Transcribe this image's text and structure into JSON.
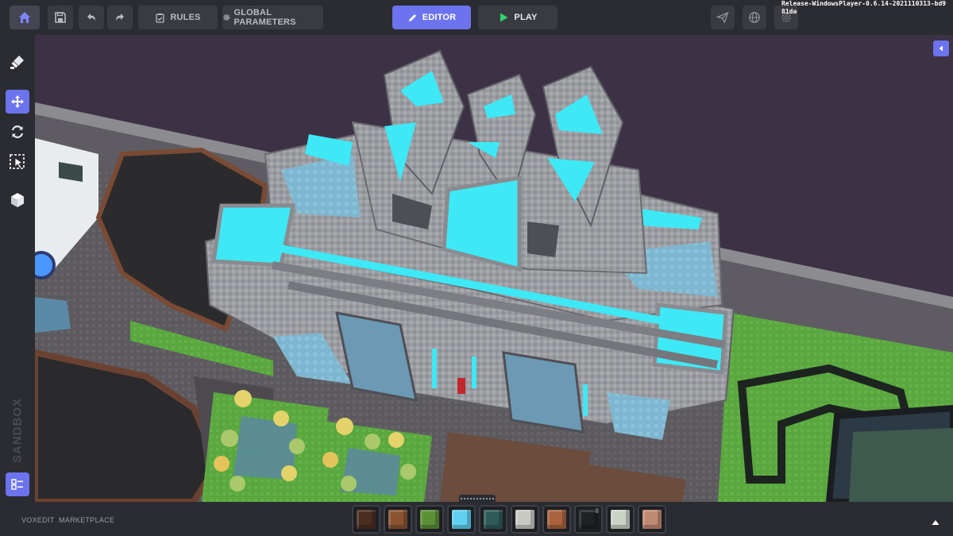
{
  "topbar": {
    "rules_label": "RULES",
    "global_params_label": "GLOBAL PARAMETERS",
    "editor_label": "EDITOR",
    "play_label": "PLAY",
    "version_text": "Release-WindowsPlayer-0.6.14-2021110313-bd981da"
  },
  "sidebar": {
    "logo_text": "SANDBOX"
  },
  "bottombar": {
    "voxedit_label": "VOXEDIT",
    "marketplace_label": "MARKETPLACE"
  },
  "hotbar": {
    "slots": [
      {
        "num": "",
        "name": "dark-wood-block",
        "color": "#4a2e1f"
      },
      {
        "num": "",
        "name": "brown-block",
        "color": "#8a5433"
      },
      {
        "num": "",
        "name": "grass-block",
        "color": "#5b8f36"
      },
      {
        "num": "",
        "name": "ice-block",
        "color": "#5fd0ef"
      },
      {
        "num": "",
        "name": "teal-block",
        "color": "#2e5a58"
      },
      {
        "num": "",
        "name": "light-stone-block",
        "color": "#c9c9c4"
      },
      {
        "num": "",
        "name": "terracotta-block",
        "color": "#a8623e"
      },
      {
        "num": "8",
        "name": "black-block",
        "color": "#1f2124"
      },
      {
        "num": "",
        "name": "pale-stone-block",
        "color": "#cbd3c6"
      },
      {
        "num": "",
        "name": "salmon-block",
        "color": "#c08a72"
      }
    ]
  },
  "colors": {
    "accent": "#6c73ee",
    "sky": "#3d3145",
    "stone": "#9a9ba0",
    "glass": "#3ee8f5",
    "grass": "#5fae42"
  }
}
